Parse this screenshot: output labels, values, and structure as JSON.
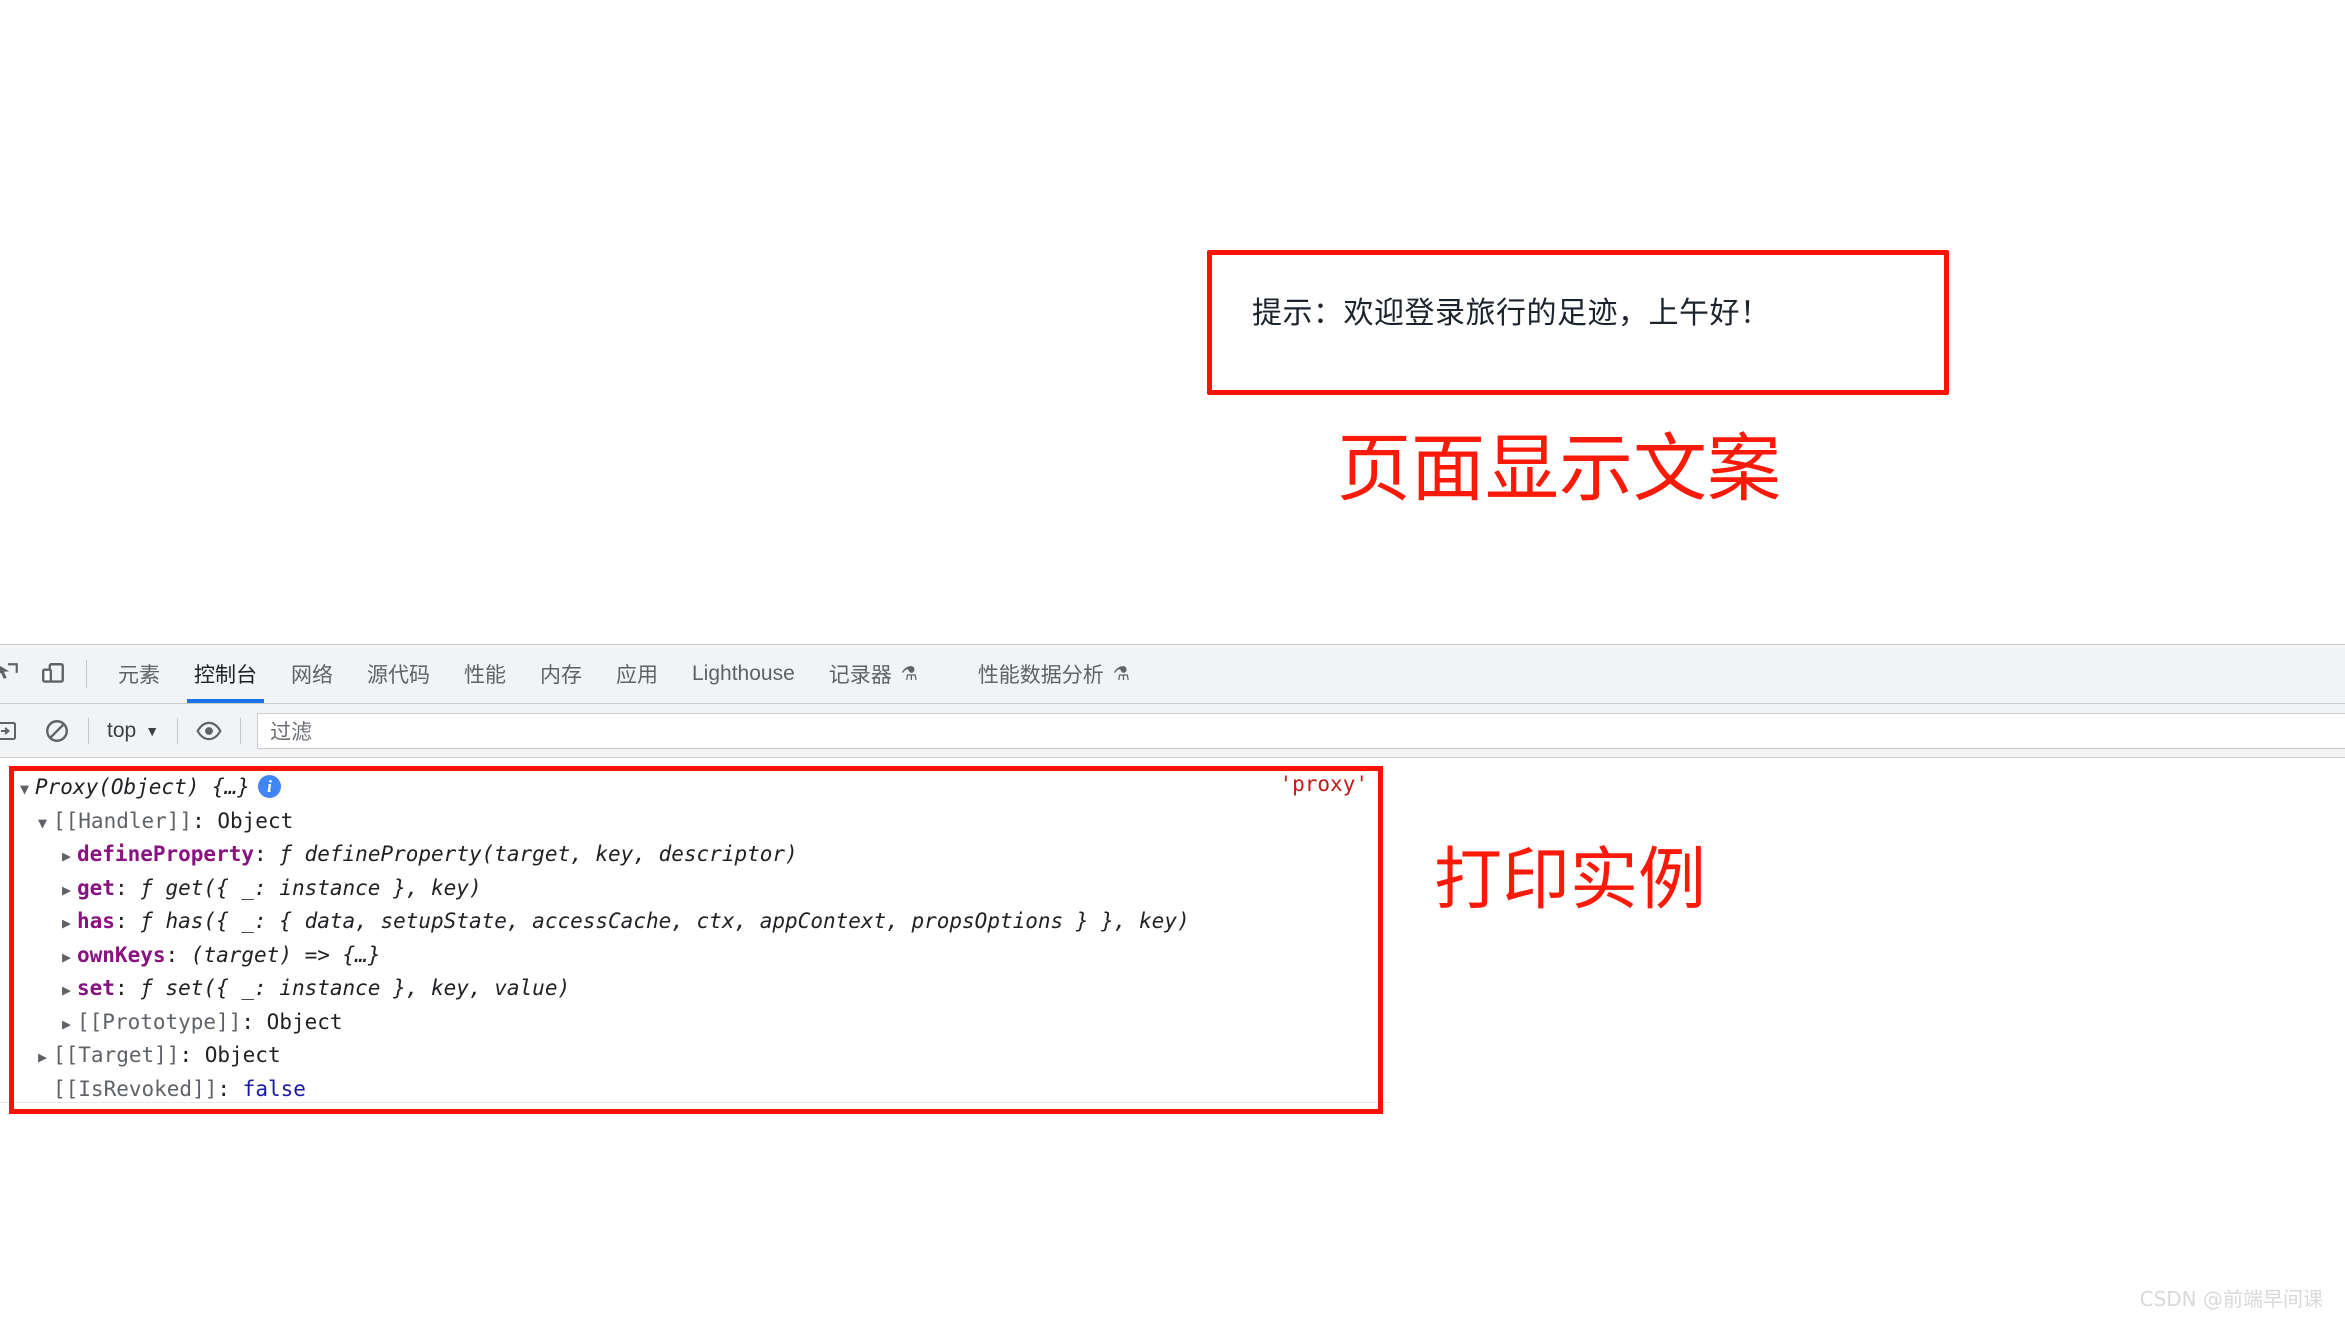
{
  "page": {
    "alert_text": "提示：欢迎登录旅行的足迹，上午好！",
    "annotation_page": "页面显示文案",
    "annotation_console": "打印实例",
    "accent_red": "#fb1200",
    "annotation_red": "#fb1a08"
  },
  "devtools": {
    "icons": {
      "inspect": "inspect-element-icon",
      "device": "device-toolbar-icon",
      "sidebar": "console-sidebar-icon",
      "clear": "clear-console-icon",
      "eye": "live-expression-icon"
    },
    "tabs": [
      {
        "label": "元素",
        "active": false,
        "flask": false
      },
      {
        "label": "控制台",
        "active": true,
        "flask": false
      },
      {
        "label": "网络",
        "active": false,
        "flask": false
      },
      {
        "label": "源代码",
        "active": false,
        "flask": false
      },
      {
        "label": "性能",
        "active": false,
        "flask": false
      },
      {
        "label": "内存",
        "active": false,
        "flask": false
      },
      {
        "label": "应用",
        "active": false,
        "flask": false
      },
      {
        "label": "Lighthouse",
        "active": false,
        "flask": false
      },
      {
        "label": "记录器",
        "active": false,
        "flask": true
      },
      {
        "label": "性能数据分析",
        "active": false,
        "flask": true
      }
    ],
    "toolbar": {
      "context_value": "top",
      "filter_placeholder": "过滤"
    },
    "console": {
      "source_label": "'proxy'",
      "rows": [
        {
          "indent": 0,
          "arrow": "open",
          "text": "Proxy(Object) {…}",
          "kind": "object-header",
          "badge": "i"
        },
        {
          "indent": 1,
          "arrow": "open",
          "key": "[[Handler]]",
          "value": "Object",
          "kind": "internal"
        },
        {
          "indent": 2,
          "arrow": "closed",
          "key": "defineProperty",
          "value": "ƒ defineProperty(target, key, descriptor)",
          "kind": "function"
        },
        {
          "indent": 2,
          "arrow": "closed",
          "key": "get",
          "value": "ƒ get({ _: instance }, key)",
          "kind": "function"
        },
        {
          "indent": 2,
          "arrow": "closed",
          "key": "has",
          "value": "ƒ has({ _: { data, setupState, accessCache, ctx, appContext, propsOptions } }, key)",
          "kind": "function"
        },
        {
          "indent": 2,
          "arrow": "closed",
          "key": "ownKeys",
          "value": "(target) => {…}",
          "kind": "arrow-function"
        },
        {
          "indent": 2,
          "arrow": "closed",
          "key": "set",
          "value": "ƒ set({ _: instance }, key, value)",
          "kind": "function"
        },
        {
          "indent": 2,
          "arrow": "closed",
          "key": "[[Prototype]]",
          "value": "Object",
          "kind": "internal"
        },
        {
          "indent": 1,
          "arrow": "closed",
          "key": "[[Target]]",
          "value": "Object",
          "kind": "internal"
        },
        {
          "indent": 1,
          "arrow": "blank",
          "key": "[[IsRevoked]]",
          "value": "false",
          "kind": "boolean"
        }
      ]
    }
  },
  "watermark": "CSDN @前端早间课"
}
